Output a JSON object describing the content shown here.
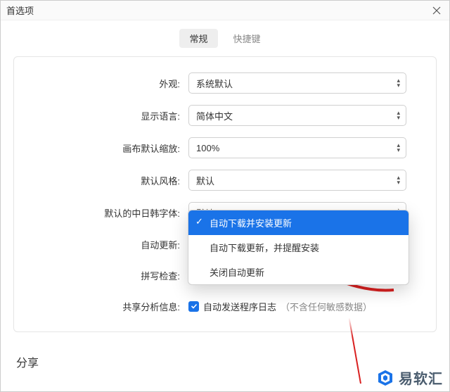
{
  "window": {
    "title": "首选项"
  },
  "tabs": {
    "general": "常规",
    "shortcuts": "快捷键"
  },
  "fields": {
    "appearance": {
      "label": "外观:",
      "value": "系统默认"
    },
    "language": {
      "label": "显示语言:",
      "value": "简体中文"
    },
    "canvasZoom": {
      "label": "画布默认缩放:",
      "value": "100%"
    },
    "defaultStyle": {
      "label": "默认风格:",
      "value": "默认"
    },
    "cjkFont": {
      "label": "默认的中日韩字体:",
      "value": "默认"
    },
    "autoUpdate": {
      "label": "自动更新:"
    },
    "spellCheck": {
      "label": "拼写检查:"
    },
    "analytics": {
      "label": "共享分析信息:",
      "checkboxLabel": "自动发送程序日志",
      "hint": "（不含任何敏感数据）"
    }
  },
  "autoUpdateOptions": {
    "opt1": "自动下载并安装更新",
    "opt2": "自动下载更新，并提醒安装",
    "opt3": "关闭自动更新"
  },
  "shareSection": "分享",
  "watermark": "易软汇"
}
